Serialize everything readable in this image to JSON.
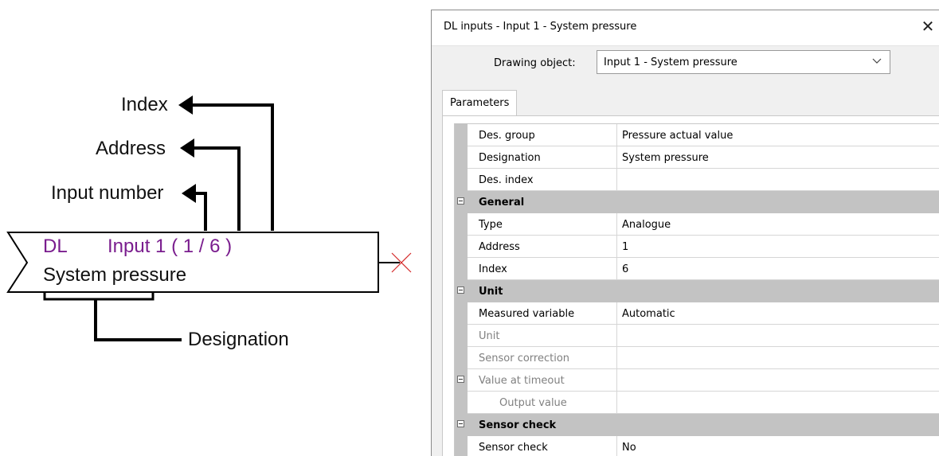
{
  "diagram": {
    "labels": {
      "index": "Index",
      "address": "Address",
      "input_number": "Input number",
      "designation": "Designation"
    },
    "block": {
      "prefix": "DL",
      "input_text": "Input 1 ( 1 / 6 )",
      "name": "System pressure"
    },
    "colors": {
      "accent": "#7a1d8e",
      "line": "#000000",
      "x_mark": "#d42a2a"
    }
  },
  "dialog": {
    "title": "DL inputs - Input 1 - System pressure",
    "close_glyph": "✕",
    "drawing_object": {
      "label": "Drawing object:",
      "value": "Input 1 - System pressure"
    },
    "tabs": [
      {
        "label": "Parameters"
      }
    ],
    "rows": [
      {
        "name": "Des. group",
        "value": "Pressure actual value"
      },
      {
        "name": "Designation",
        "value": "System pressure"
      },
      {
        "name": "Des. index",
        "value": ""
      },
      {
        "name": "General",
        "value": ""
      },
      {
        "name": "Type",
        "value": "Analogue"
      },
      {
        "name": "Address",
        "value": "1"
      },
      {
        "name": "Index",
        "value": "6"
      },
      {
        "name": "Unit",
        "value": ""
      },
      {
        "name": "Measured variable",
        "value": "Automatic"
      },
      {
        "name": "Unit",
        "value": ""
      },
      {
        "name": "Sensor correction",
        "value": ""
      },
      {
        "name": "Value at timeout",
        "value": ""
      },
      {
        "name": "Output value",
        "value": ""
      },
      {
        "name": "Sensor check",
        "value": ""
      },
      {
        "name": "Sensor check",
        "value": "No"
      }
    ]
  }
}
